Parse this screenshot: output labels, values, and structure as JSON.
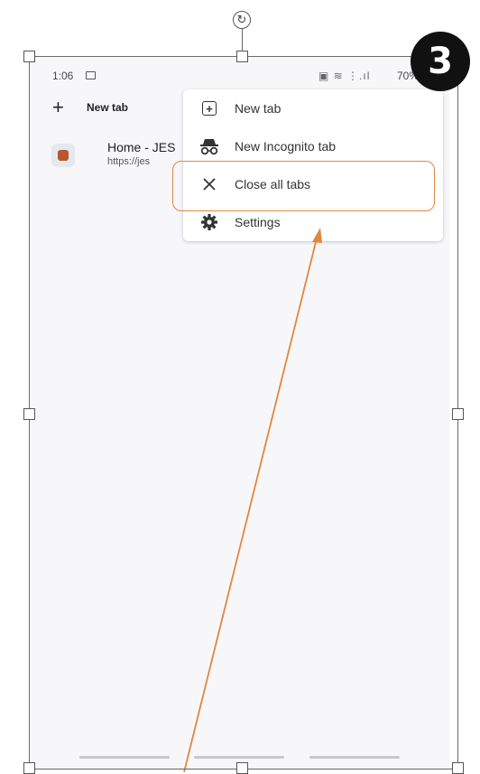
{
  "status_bar": {
    "time": "1:06",
    "battery": "70%"
  },
  "tab_switcher": {
    "new_tab_label": "New tab",
    "tab": {
      "title": "Home - JES",
      "url": "https://jes"
    }
  },
  "menu": {
    "items": [
      {
        "label": "New tab",
        "icon": "new-tab-icon"
      },
      {
        "label": "New Incognito tab",
        "icon": "incognito-icon"
      },
      {
        "label": "Close all tabs",
        "icon": "close-icon"
      },
      {
        "label": "Settings",
        "icon": "settings-gear-icon"
      }
    ]
  },
  "annotation": {
    "step_number": "3",
    "highlight_color": "#e4853e",
    "arrow_color": "#e4853e",
    "highlighted_item": "Close all tabs"
  }
}
